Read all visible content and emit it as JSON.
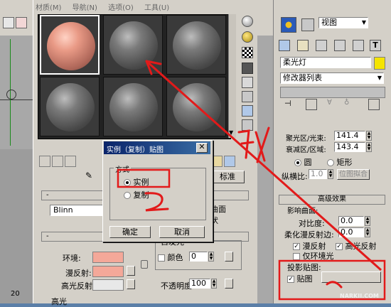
{
  "material_editor": {
    "menu": [
      "材质(M)",
      "导航(N)",
      "选项(O)",
      "工具(U)"
    ],
    "shader": "Blinn",
    "basic_params": {
      "ambient": "环境:",
      "diffuse": "漫反射:",
      "specular": "高光反射:",
      "self_illum": "自发光",
      "color_check": "颜色",
      "self_illum_value": "0",
      "opacity": "不透明度:",
      "opacity_value": "100",
      "highlights": "高光",
      "wire_face": "曲面",
      "faceted": "状"
    },
    "standard_label": "标准"
  },
  "dialog": {
    "title": "实例（复制）贴图",
    "group": "方式",
    "options": [
      "实例",
      "复制"
    ],
    "ok": "确定",
    "cancel": "取消"
  },
  "command_panel": {
    "view_dropdown": "视图",
    "object_name": "柔光灯",
    "modifier_list": "修改器列表",
    "hotspot_label": "聚光区/光束:",
    "hotspot_value": "141.4",
    "falloff_label": "衰减区/区域:",
    "falloff_value": "143.4",
    "circle": "圆",
    "rectangle": "矩形",
    "aspect_label": "纵横比:",
    "aspect_value": "1.0",
    "bitmap_fit": "位图拟合",
    "advanced_effects": "高级效果",
    "affect_surfaces": "影响曲面:",
    "contrast_label": "对比度:",
    "contrast_value": "0.0",
    "soften_label": "柔化漫反射边:",
    "soften_value": "0.0",
    "diffuse_check": "漫反射",
    "specular_check": "高光反射",
    "ambient_only": "仅环境光",
    "projector_map": "投影贴图:",
    "map_check": "贴图"
  },
  "viewport": {
    "frame_number": "20"
  },
  "annotations": {
    "drag_text": "拉入",
    "number_2": "2",
    "number_1": "1",
    "watermark": "NARKII.COM"
  },
  "colors": {
    "ui_gray": "#d4d0c8",
    "viewport_blue": "#5b7fa8",
    "annotation_red": "#e21a1a",
    "swatch_pink": "#f4a899",
    "light_yellow": "#f5e400"
  }
}
